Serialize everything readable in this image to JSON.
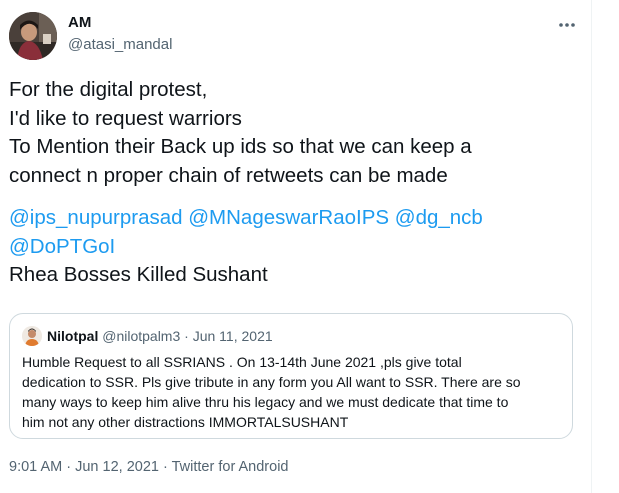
{
  "author": {
    "name": "AM",
    "handle": "@atasi_mandal"
  },
  "tweet": {
    "lines": [
      "For the digital protest,",
      "I'd like to request warriors",
      "To Mention their Back up ids so that we can keep a",
      "connect n proper chain of retweets can be made"
    ],
    "mentions": [
      "@ips_nupurprasad",
      "@MNageswarRaoIPS",
      "@dg_ncb",
      "@DoPTGoI"
    ],
    "closing": "Rhea Bosses Killed Sushant"
  },
  "quoted_tweet": {
    "name": "Nilotpal",
    "handle": "@nilotpalm3",
    "separator": "·",
    "date": "Jun 11, 2021",
    "lines": [
      "Humble Request to all SSRIANS . On  13-14th June 2021 ,pls give total",
      "dedication to SSR. Pls give tribute in any form you All want  to SSR. There are so",
      "many ways to keep him alive thru his legacy and we must dedicate that time to",
      "him not any other distractions IMMORTALSUSHANT"
    ]
  },
  "meta": {
    "time": "9:01 AM",
    "date": "Jun 12, 2021",
    "separator": "·",
    "source": "Twitter for Android"
  },
  "icons": {
    "more": "more-horizontal-icon",
    "avatar": "profile-photo",
    "quote_avatar": "profile-photo"
  },
  "colors": {
    "link": "#1d9bf0",
    "secondary_text": "#536471",
    "primary_text": "#0f1419",
    "border": "#cfd9de"
  }
}
